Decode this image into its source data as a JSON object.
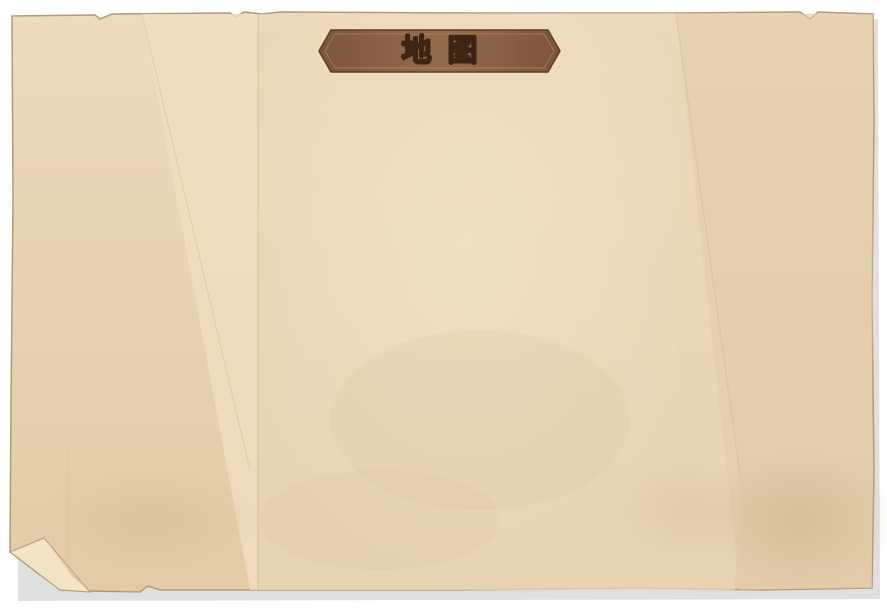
{
  "map_panel": {
    "title": "地图"
  },
  "colors": {
    "paper": "#e8d5b5",
    "paper_light": "#f0e0c2",
    "paper_dark": "#dcc6a1",
    "edge": "#b59c77",
    "banner": "#8d6447",
    "banner_trim": "#f2dcb8",
    "title_text": "#fbf1dc"
  }
}
